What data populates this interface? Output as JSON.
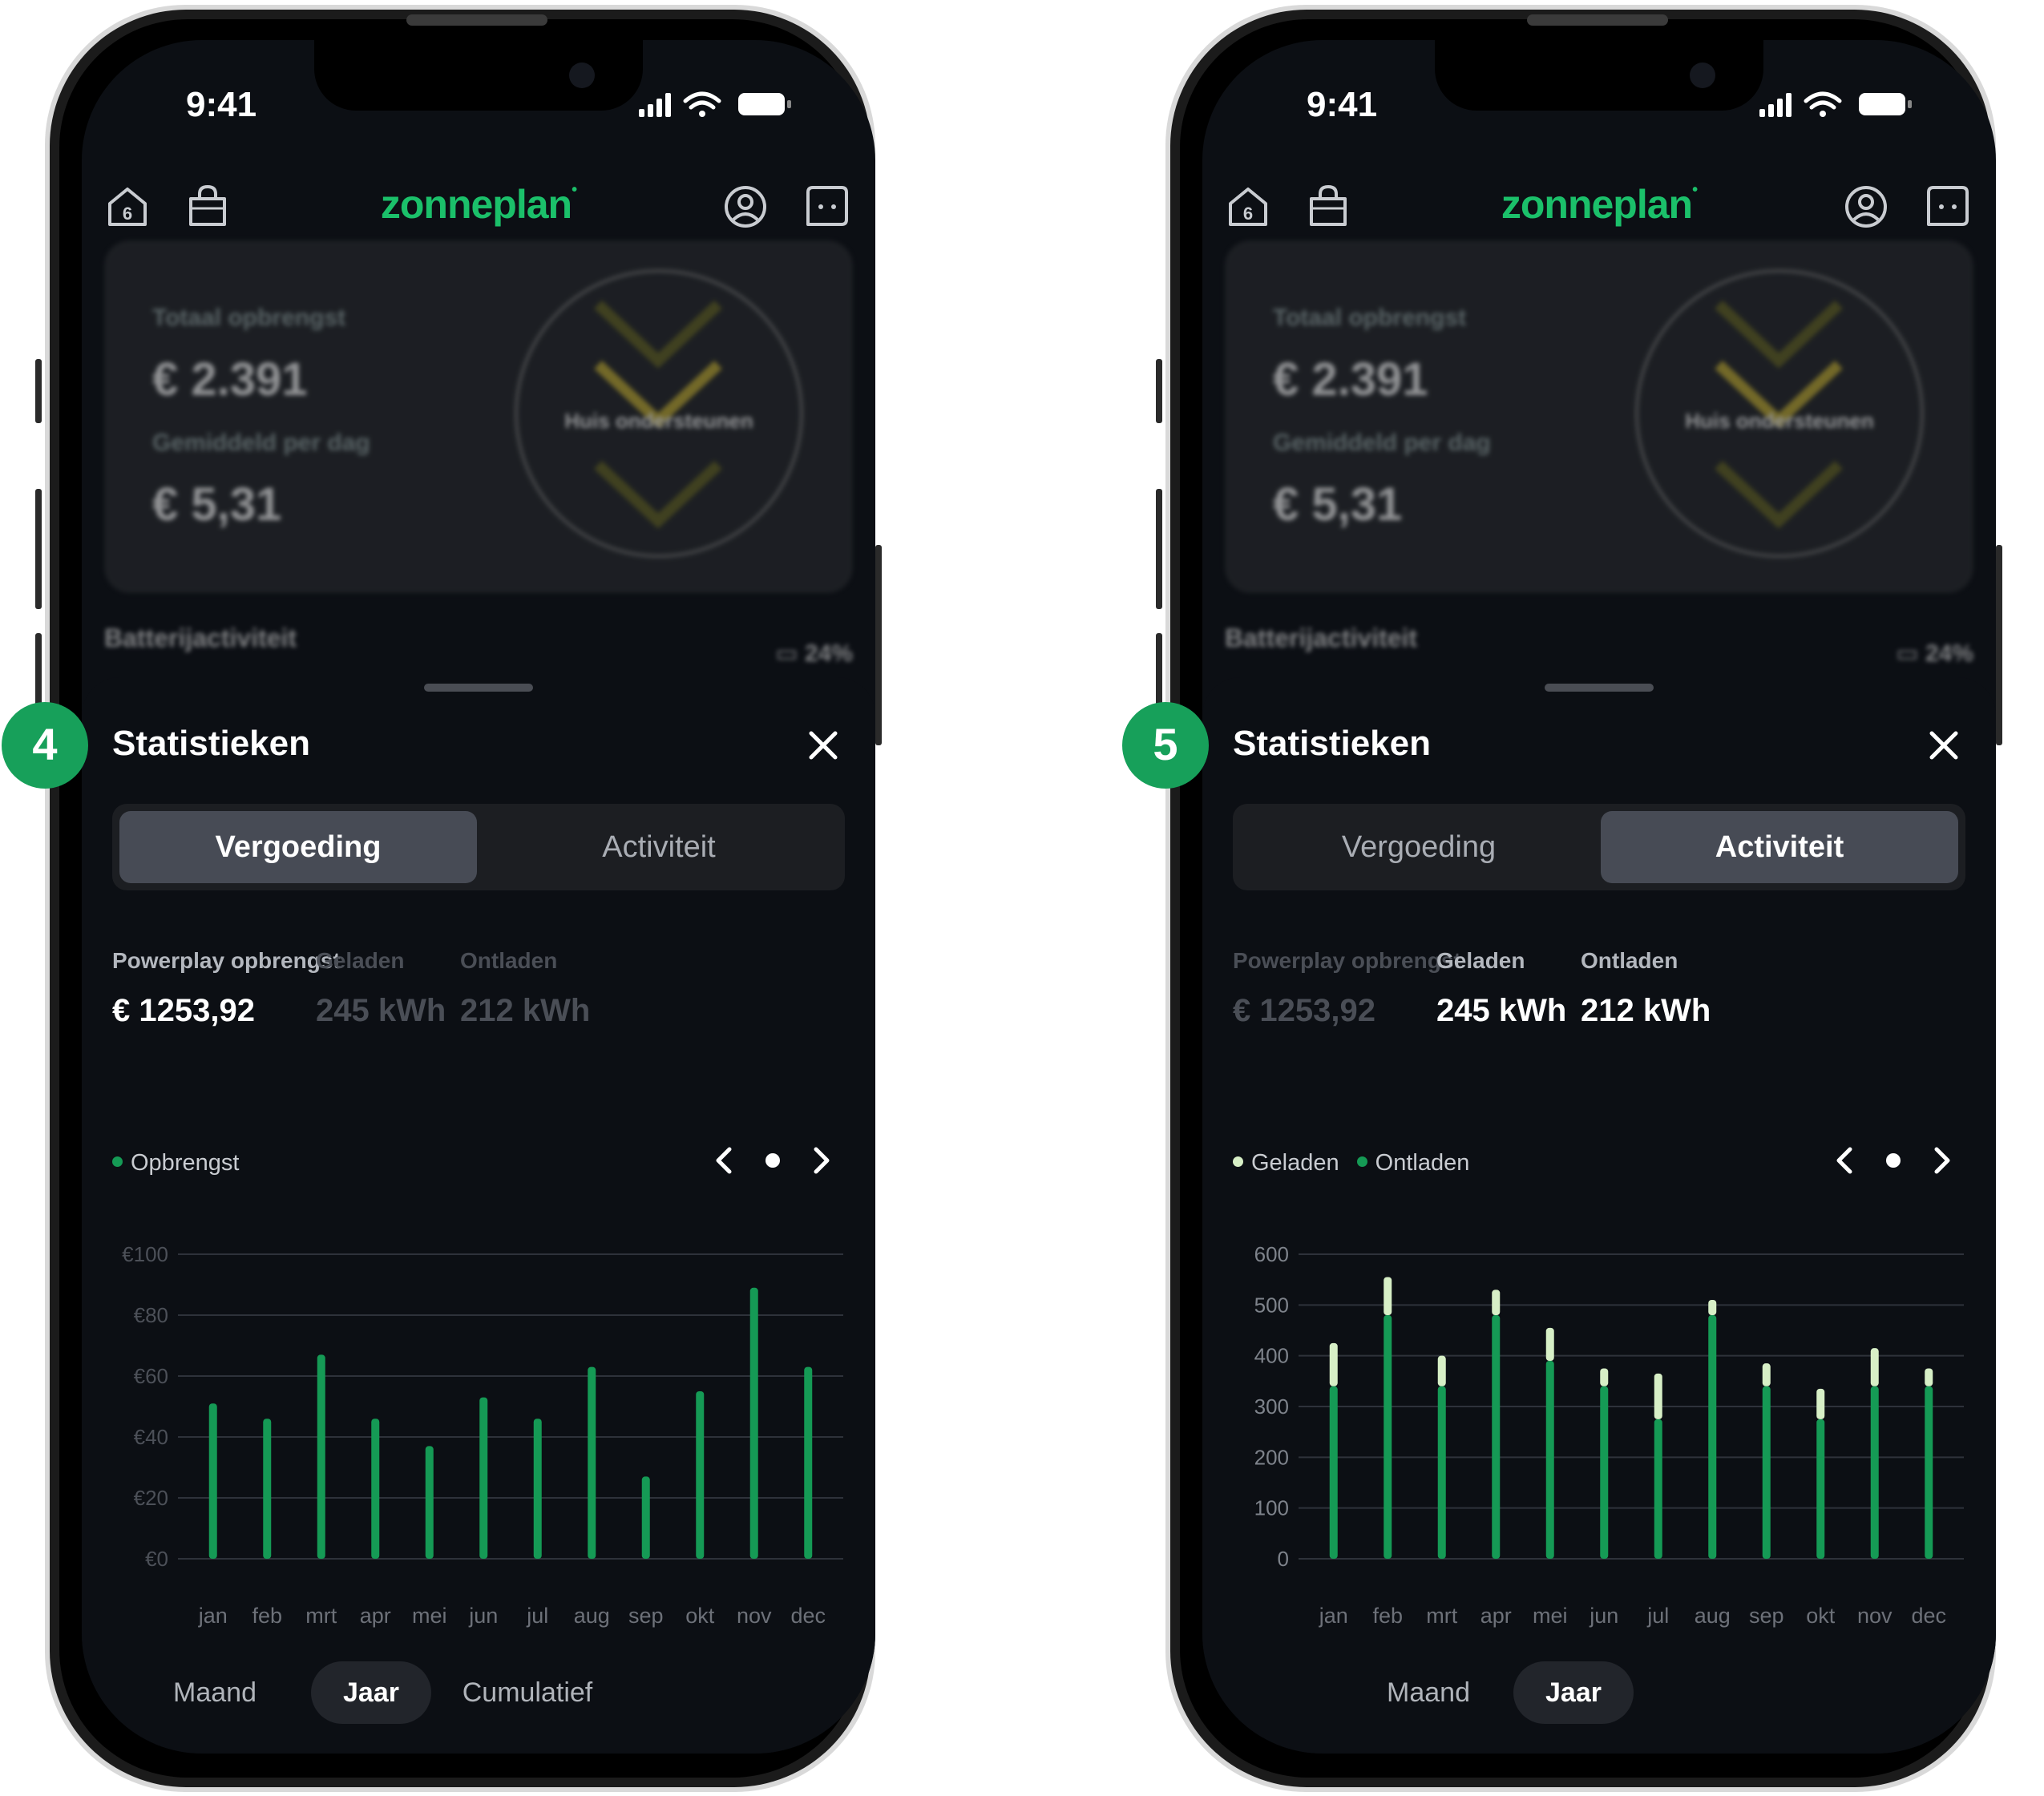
{
  "colors": {
    "brand": "#1bc06a",
    "bar_green": "#159a55",
    "bar_light": "#d7efc6",
    "sheet_bg": "#0c0f14",
    "badge": "#17a05a"
  },
  "phones": [
    {
      "step": "4",
      "status": {
        "time": "9:41"
      },
      "appbar": {
        "logo": "zonneplan",
        "home_badge": "6"
      },
      "background_card": {
        "total_label": "Totaal opbrengst",
        "total_value": "€ 2.391",
        "avg_label": "Gemiddeld per dag",
        "avg_value": "€ 5,31",
        "circle_label": "Huis ondersteunen",
        "battery_label": "Batterijactiviteit",
        "battery_pct": "24%"
      },
      "sheet": {
        "title": "Statistieken",
        "tabs": [
          {
            "label": "Vergoeding",
            "active": true
          },
          {
            "label": "Activiteit",
            "active": false
          }
        ],
        "stats": [
          {
            "label": "Powerplay opbrengst",
            "value": "€ 1253,92",
            "dim": false
          },
          {
            "label": "Geladen",
            "value": "245 kWh",
            "dim": true
          },
          {
            "label": "Ontladen",
            "value": "212 kWh",
            "dim": true
          }
        ],
        "legend": [
          {
            "label": "Opbrengst",
            "color": "#159a55"
          }
        ],
        "periods": [
          {
            "label": "Maand",
            "active": false
          },
          {
            "label": "Jaar",
            "active": true
          },
          {
            "label": "Cumulatief",
            "active": false
          }
        ]
      }
    },
    {
      "step": "5",
      "status": {
        "time": "9:41"
      },
      "appbar": {
        "logo": "zonneplan",
        "home_badge": "6"
      },
      "background_card": {
        "total_label": "Totaal opbrengst",
        "total_value": "€ 2.391",
        "avg_label": "Gemiddeld per dag",
        "avg_value": "€ 5,31",
        "circle_label": "Huis ondersteunen",
        "battery_label": "Batterijactiviteit",
        "battery_pct": "24%"
      },
      "sheet": {
        "title": "Statistieken",
        "tabs": [
          {
            "label": "Vergoeding",
            "active": false
          },
          {
            "label": "Activiteit",
            "active": true
          }
        ],
        "stats": [
          {
            "label": "Powerplay opbrengst",
            "value": "€ 1253,92",
            "dim": true
          },
          {
            "label": "Geladen",
            "value": "245 kWh",
            "dim": false
          },
          {
            "label": "Ontladen",
            "value": "212 kWh",
            "dim": false
          }
        ],
        "legend": [
          {
            "label": "Geladen",
            "color": "#d7efc6"
          },
          {
            "label": "Ontladen",
            "color": "#159a55"
          }
        ],
        "periods": [
          {
            "label": "Maand",
            "active": false
          },
          {
            "label": "Jaar",
            "active": true
          }
        ]
      }
    }
  ],
  "chart_data": [
    {
      "type": "bar",
      "categories": [
        "jan",
        "feb",
        "mrt",
        "apr",
        "mei",
        "jun",
        "jul",
        "aug",
        "sep",
        "okt",
        "nov",
        "dec"
      ],
      "series": [
        {
          "name": "Opbrengst",
          "values": [
            51,
            46,
            67,
            46,
            37,
            53,
            46,
            63,
            27,
            55,
            89,
            63
          ]
        }
      ],
      "yticks": [
        "€0",
        "€20",
        "€40",
        "€60",
        "€80",
        "€100"
      ],
      "ylim": [
        0,
        100
      ],
      "grid": true,
      "legend": "top-left"
    },
    {
      "type": "bar",
      "stacked": true,
      "categories": [
        "jan",
        "feb",
        "mrt",
        "apr",
        "mei",
        "jun",
        "jul",
        "aug",
        "sep",
        "okt",
        "nov",
        "dec"
      ],
      "series": [
        {
          "name": "Ontladen",
          "values": [
            340,
            480,
            340,
            480,
            390,
            340,
            275,
            480,
            340,
            275,
            340,
            340
          ]
        },
        {
          "name": "Geladen",
          "values": [
            85,
            75,
            60,
            50,
            65,
            35,
            90,
            30,
            45,
            60,
            75,
            35
          ]
        }
      ],
      "yticks": [
        "0",
        "100",
        "200",
        "300",
        "400",
        "500",
        "600"
      ],
      "ylim": [
        0,
        600
      ],
      "grid": true,
      "legend": "top-left"
    }
  ]
}
